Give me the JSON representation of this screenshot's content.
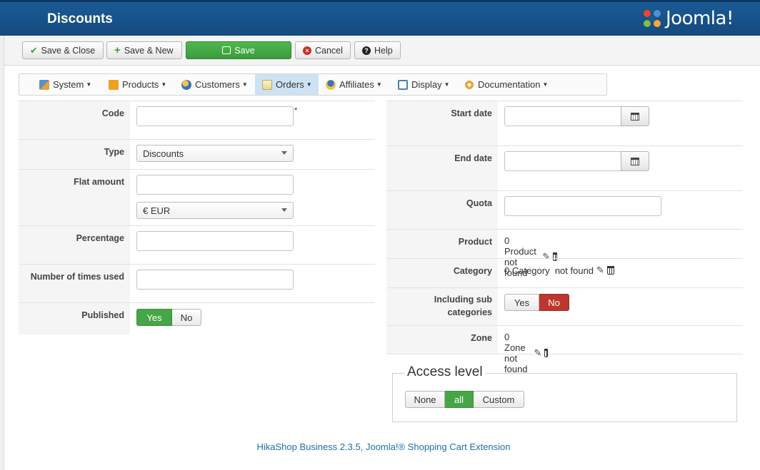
{
  "header": {
    "title": "Discounts",
    "logo_text": "Joomla!"
  },
  "toolbar": {
    "save_close": "Save & Close",
    "save_new": "Save & New",
    "save": "Save",
    "cancel": "Cancel",
    "help": "Help"
  },
  "menu": {
    "items": [
      {
        "label": "System",
        "icon": "tools-icon"
      },
      {
        "label": "Products",
        "icon": "products-icon"
      },
      {
        "label": "Customers",
        "icon": "customers-icon"
      },
      {
        "label": "Orders",
        "icon": "orders-icon"
      },
      {
        "label": "Affiliates",
        "icon": "affiliates-icon"
      },
      {
        "label": "Display",
        "icon": "display-icon"
      },
      {
        "label": "Documentation",
        "icon": "documentation-icon"
      }
    ],
    "active": "Orders"
  },
  "form_left": {
    "code_label": "Code",
    "code_value": "",
    "required_mark": "*",
    "type_label": "Type",
    "type_value": "Discounts",
    "flat_amount_label": "Flat amount",
    "flat_amount_value": "",
    "currency_value": "€ EUR",
    "percentage_label": "Percentage",
    "percentage_value": "",
    "times_used_label": "Number of times used",
    "times_used_value": "",
    "published_label": "Published",
    "published_yes": "Yes",
    "published_no": "No",
    "published_selected": "Yes"
  },
  "form_right": {
    "start_date_label": "Start date",
    "start_date_value": "",
    "end_date_label": "End date",
    "end_date_value": "",
    "quota_label": "Quota",
    "quota_value": "",
    "product_label": "Product",
    "product_value": "0 Product not found",
    "category_label": "Category",
    "category_value": "0 Category  not found",
    "including_sub_label_line1": "Including sub",
    "including_sub_label_line2": "categories",
    "including_yes": "Yes",
    "including_no": "No",
    "including_selected": "No",
    "zone_label": "Zone",
    "zone_value": "0 Zone not found"
  },
  "access": {
    "legend": "Access level",
    "options": [
      "None",
      "all",
      "Custom"
    ],
    "selected": "all"
  },
  "footer": {
    "text": "HikaShop Business 2.3.5, Joomla!® Shopping Cart Extension"
  },
  "colors": {
    "header_blue": "#1b5a96",
    "green": "#46a546",
    "red": "#bd362f",
    "link": "#1e6fa8"
  }
}
